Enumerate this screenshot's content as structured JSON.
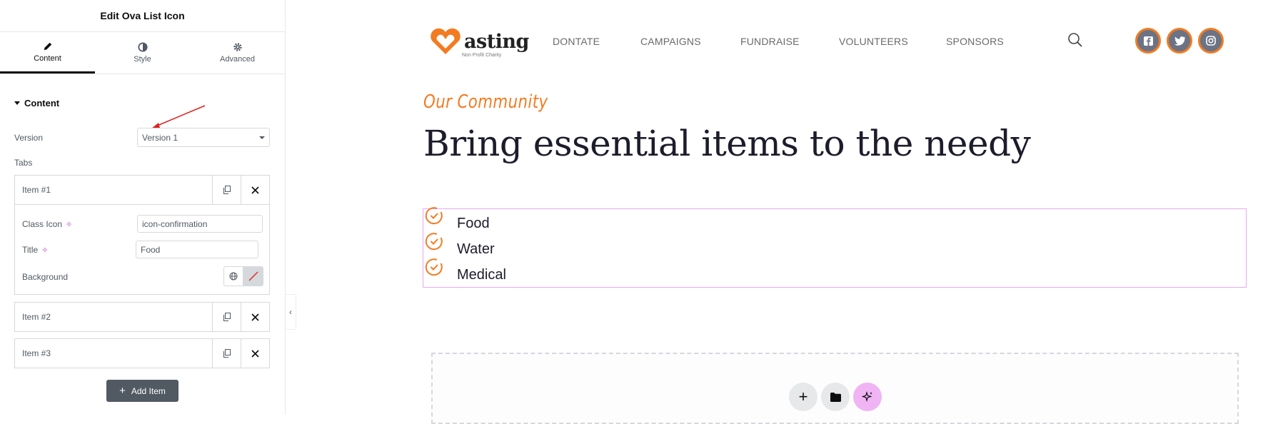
{
  "panel": {
    "title": "Edit Ova List Icon",
    "tabs": [
      {
        "label": "Content",
        "icon": "pencil-icon",
        "active": true
      },
      {
        "label": "Style",
        "icon": "half-circle-icon",
        "active": false
      },
      {
        "label": "Advanced",
        "icon": "gear-icon",
        "active": false
      }
    ],
    "section_title": "Content",
    "version_label": "Version",
    "version_value": "Version 1",
    "tabs_label": "Tabs",
    "items": [
      {
        "title": "Item #1",
        "expanded": true
      },
      {
        "title": "Item #2",
        "expanded": false
      },
      {
        "title": "Item #3",
        "expanded": false
      }
    ],
    "item1_fields": {
      "class_icon_label": "Class Icon",
      "class_icon_value": "icon-confirmation",
      "title_label": "Title",
      "title_value": "Food",
      "background_label": "Background"
    },
    "add_item_label": "Add Item",
    "annotation_arrow_color": "#e02020"
  },
  "preview": {
    "logo": {
      "text": "asting",
      "sub": "Non Profit Charity",
      "accent": "#f37b21"
    },
    "nav": [
      "DONTATE",
      "CAMPAIGNS",
      "FUNDRAISE",
      "VOLUNTEERS",
      "SPONSORS"
    ],
    "social": [
      "facebook-icon",
      "twitter-icon",
      "instagram-icon"
    ],
    "tagline": "Our Community",
    "heading": "Bring essential items to the needy",
    "list": [
      "Food",
      "Water",
      "Medical"
    ],
    "accent": "#f37b21",
    "selection_border": "#e5a8f0",
    "dropzone_buttons": [
      "add-icon",
      "folder-icon",
      "ai-sparkle-icon"
    ]
  }
}
